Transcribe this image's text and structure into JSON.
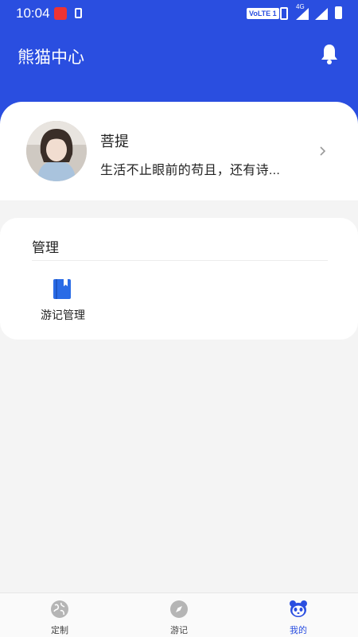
{
  "status_bar": {
    "time": "10:04",
    "volte": "VoLTE 1",
    "network": "4G"
  },
  "header": {
    "title": "熊猫中心",
    "bell_icon": "bell-icon"
  },
  "profile": {
    "name": "菩提",
    "bio": "生活不止眼前的苟且，还有诗..."
  },
  "management": {
    "title": "管理",
    "items": [
      {
        "label": "游记管理",
        "icon": "book-icon"
      }
    ]
  },
  "tabbar": {
    "items": [
      {
        "label": "定制",
        "icon": "globe-icon"
      },
      {
        "label": "游记",
        "icon": "compass-icon"
      },
      {
        "label": "我的",
        "icon": "panda-icon",
        "active": true
      }
    ]
  },
  "colors": {
    "primary": "#2a4ee0",
    "background": "#f4f4f4",
    "card": "#ffffff"
  }
}
